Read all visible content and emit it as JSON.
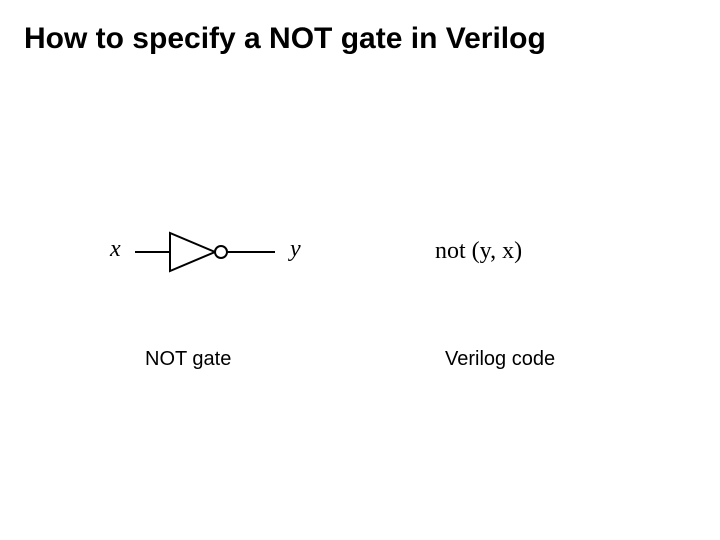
{
  "title": "How to specify a NOT gate in Verilog",
  "diagram": {
    "input_label": "x",
    "output_label": "y",
    "gate_caption": "NOT gate"
  },
  "code": {
    "statement": "not (y, x)",
    "caption": "Verilog code"
  }
}
